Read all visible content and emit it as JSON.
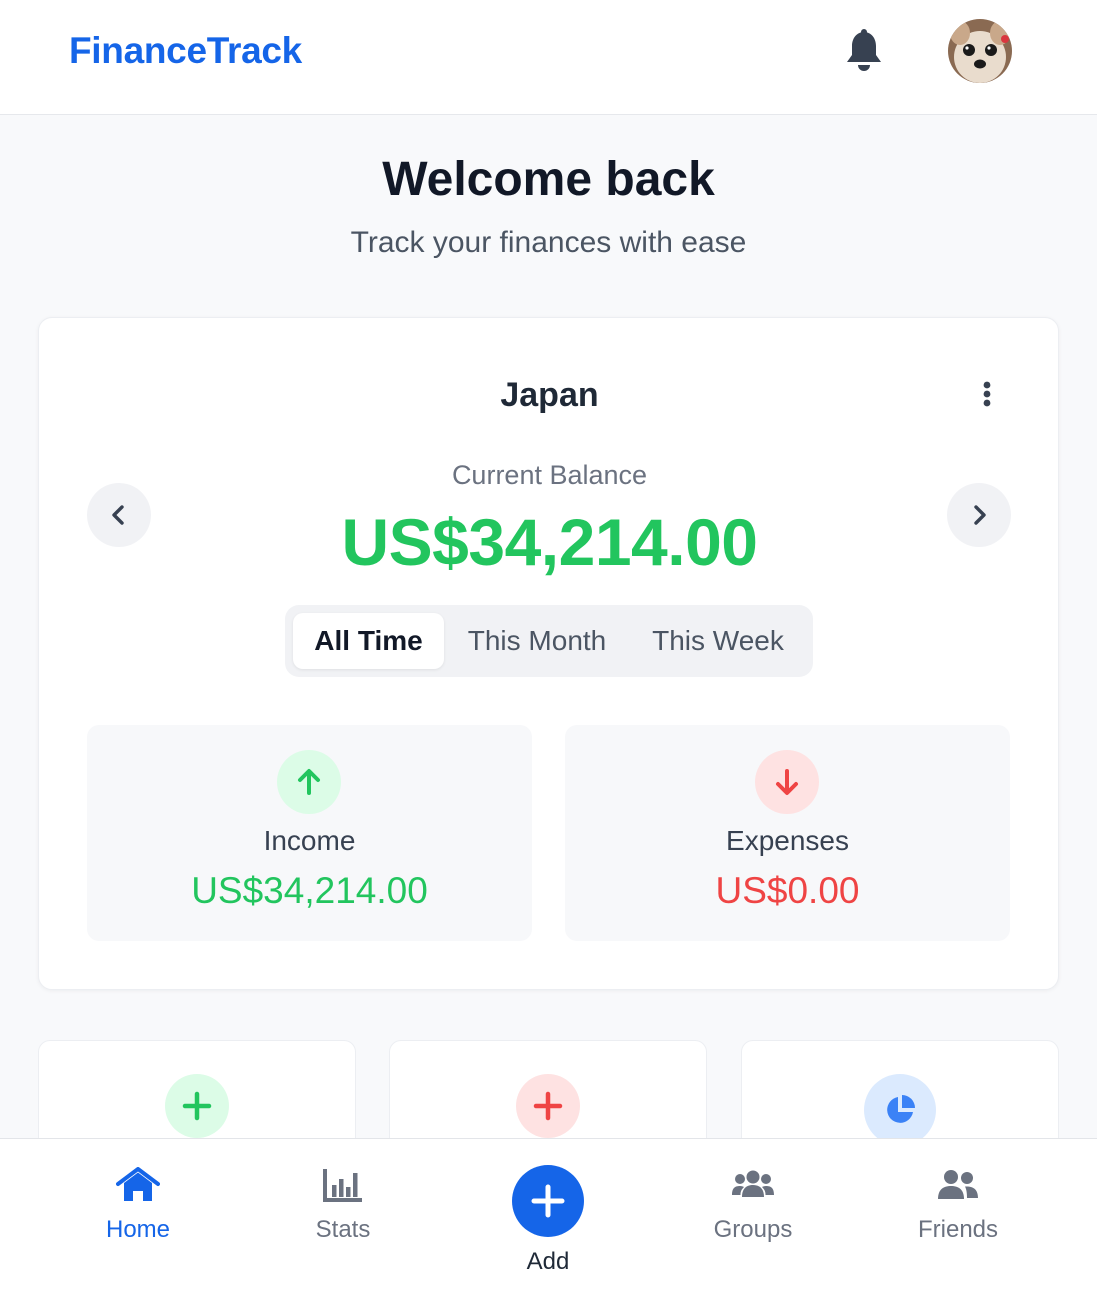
{
  "header": {
    "brand": "FinanceTrack",
    "icons": {
      "notifications": "bell-icon",
      "profile": "avatar"
    }
  },
  "welcome": {
    "title": "Welcome back",
    "subtitle": "Track your finances with ease"
  },
  "account": {
    "name": "Japan",
    "balance_label": "Current Balance",
    "balance_value": "US$34,214.00",
    "tabs": [
      "All Time",
      "This Month",
      "This Week"
    ],
    "selected_tab": "All Time",
    "income": {
      "label": "Income",
      "value": "US$34,214.00"
    },
    "expenses": {
      "label": "Expenses",
      "value": "US$0.00"
    }
  },
  "quick_actions": [
    {
      "icon": "plus-icon",
      "color": "#22c55e"
    },
    {
      "icon": "plus-icon",
      "color": "#ef4444"
    },
    {
      "icon": "pie-chart-icon",
      "color": "#3b82f6"
    }
  ],
  "bottom_nav": {
    "items": [
      "Home",
      "Stats",
      "Add",
      "Groups",
      "Friends"
    ],
    "active": "Home"
  },
  "colors": {
    "brand": "#1565e8",
    "positive": "#22c55e",
    "negative": "#ef4444"
  }
}
